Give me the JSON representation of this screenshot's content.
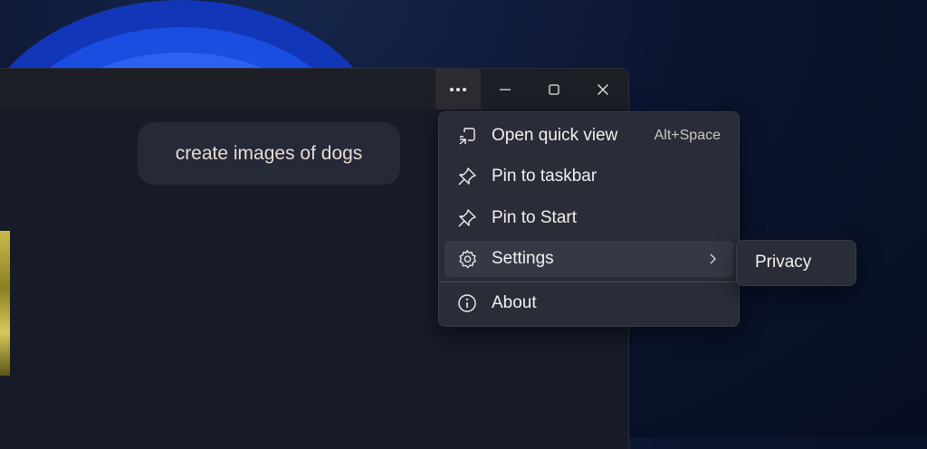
{
  "titlebar": {
    "more_icon": "more-horizontal-icon",
    "minimize_icon": "minimize-icon",
    "maximize_icon": "maximize-icon",
    "close_icon": "close-icon"
  },
  "chat": {
    "message": "create images of dogs"
  },
  "context_menu": {
    "items": [
      {
        "label": "Open quick view",
        "shortcut": "Alt+Space",
        "icon": "quick-view-icon"
      },
      {
        "label": "Pin to taskbar",
        "icon": "pin-icon"
      },
      {
        "label": "Pin to Start",
        "icon": "pin-icon"
      },
      {
        "label": "Settings",
        "icon": "gear-icon",
        "has_submenu": true
      },
      {
        "label": "About",
        "icon": "info-icon"
      }
    ]
  },
  "submenu": {
    "items": [
      {
        "label": "Privacy"
      }
    ]
  },
  "colors": {
    "menu_bg": "#2a2c37",
    "window_bg": "#171a28",
    "titlebar_bg": "#1d1f26",
    "bubble_bg": "#262938"
  }
}
